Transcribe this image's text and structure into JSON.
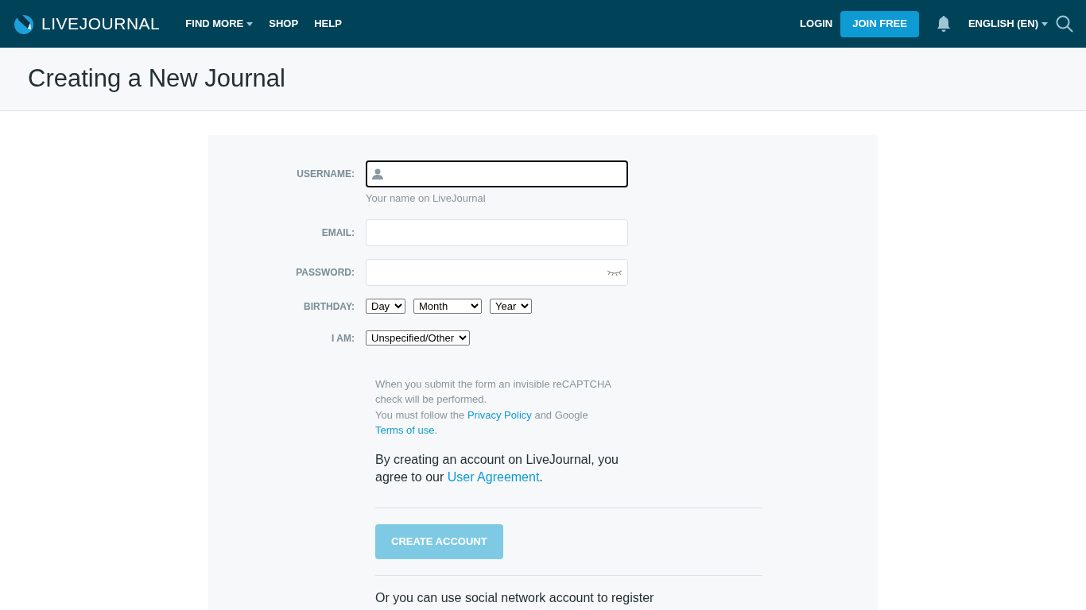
{
  "header": {
    "logo": "LIVEJOURNAL",
    "nav": [
      {
        "label": "FIND MORE",
        "dropdown": true
      },
      {
        "label": "SHOP",
        "dropdown": false
      },
      {
        "label": "HELP",
        "dropdown": false
      }
    ],
    "login": "LOGIN",
    "join": "JOIN FREE",
    "language": "ENGLISH (EN)"
  },
  "page_title": "Creating a New Journal",
  "form": {
    "fields": [
      {
        "kind": "username",
        "label": "USERNAME:",
        "focused": true,
        "hint": "Your name on LiveJournal"
      },
      {
        "kind": "text",
        "label": "EMAIL:",
        "focused": false
      },
      {
        "kind": "password",
        "label": "PASSWORD:",
        "focused": false
      },
      {
        "kind": "selects",
        "label": "BIRTHDAY:",
        "selects": [
          "Day",
          "Month",
          "Year"
        ]
      },
      {
        "kind": "selects",
        "label": "I AM:",
        "selects": [
          "Unspecified/Other"
        ]
      }
    ],
    "recaptcha": [
      {
        "kind": "text",
        "text": "When you submit the form an invisible reCAPTCHA check will be performed."
      },
      {
        "kind": "break"
      },
      {
        "kind": "text",
        "text": "You must follow the "
      },
      {
        "kind": "link",
        "text": "Privacy Policy"
      },
      {
        "kind": "text",
        "text": " and Google "
      },
      {
        "kind": "link",
        "text": "Terms of use"
      },
      {
        "kind": "text",
        "text": "."
      }
    ],
    "agreement": [
      {
        "kind": "text",
        "text": "By creating an account on LiveJournal, you agree to our "
      },
      {
        "kind": "link",
        "text": "User Agreement"
      },
      {
        "kind": "text",
        "text": "."
      }
    ],
    "submit": {
      "label": "CREATE ACCOUNT",
      "disabled": true
    },
    "social_note": "Or you can use social network account to register"
  }
}
